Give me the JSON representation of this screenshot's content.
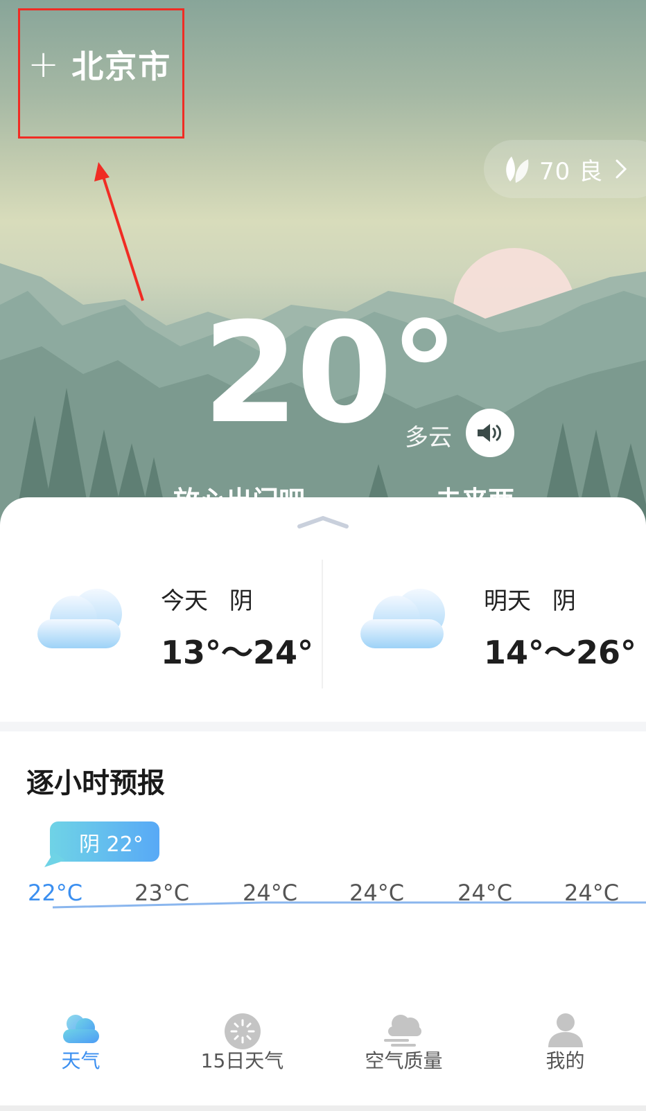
{
  "header": {
    "add_icon": "plus-icon",
    "city": "北京市"
  },
  "aqi": {
    "icon": "leaf-icon",
    "label": "70 良",
    "chevron": "chevron-right-icon"
  },
  "current": {
    "temperature": "20°",
    "condition": "多云",
    "voice_icon": "speaker-icon",
    "tip_left": "放心出门吧",
    "tip_right": "未来两"
  },
  "forecast": {
    "today": {
      "day": "今天",
      "condition": "阴",
      "range": "13°～24°",
      "icon": "cloud-icon"
    },
    "tomorrow": {
      "day": "明天",
      "condition": "阴",
      "range": "14°～26°",
      "icon": "cloud-icon"
    }
  },
  "hourly": {
    "title": "逐小时预报",
    "bubble": "阴 22°",
    "temps": [
      "22°C",
      "23°C",
      "24°C",
      "24°C",
      "24°C",
      "24°C"
    ]
  },
  "tabs": [
    {
      "label": "天气",
      "icon": "cloud-icon",
      "active": true
    },
    {
      "label": "15日天气",
      "icon": "sun-icon",
      "active": false
    },
    {
      "label": "空气质量",
      "icon": "wind-cloud-icon",
      "active": false
    },
    {
      "label": "我的",
      "icon": "user-icon",
      "active": false
    }
  ],
  "colors": {
    "accent": "#3b8ff0",
    "annotation": "#f02c24"
  }
}
